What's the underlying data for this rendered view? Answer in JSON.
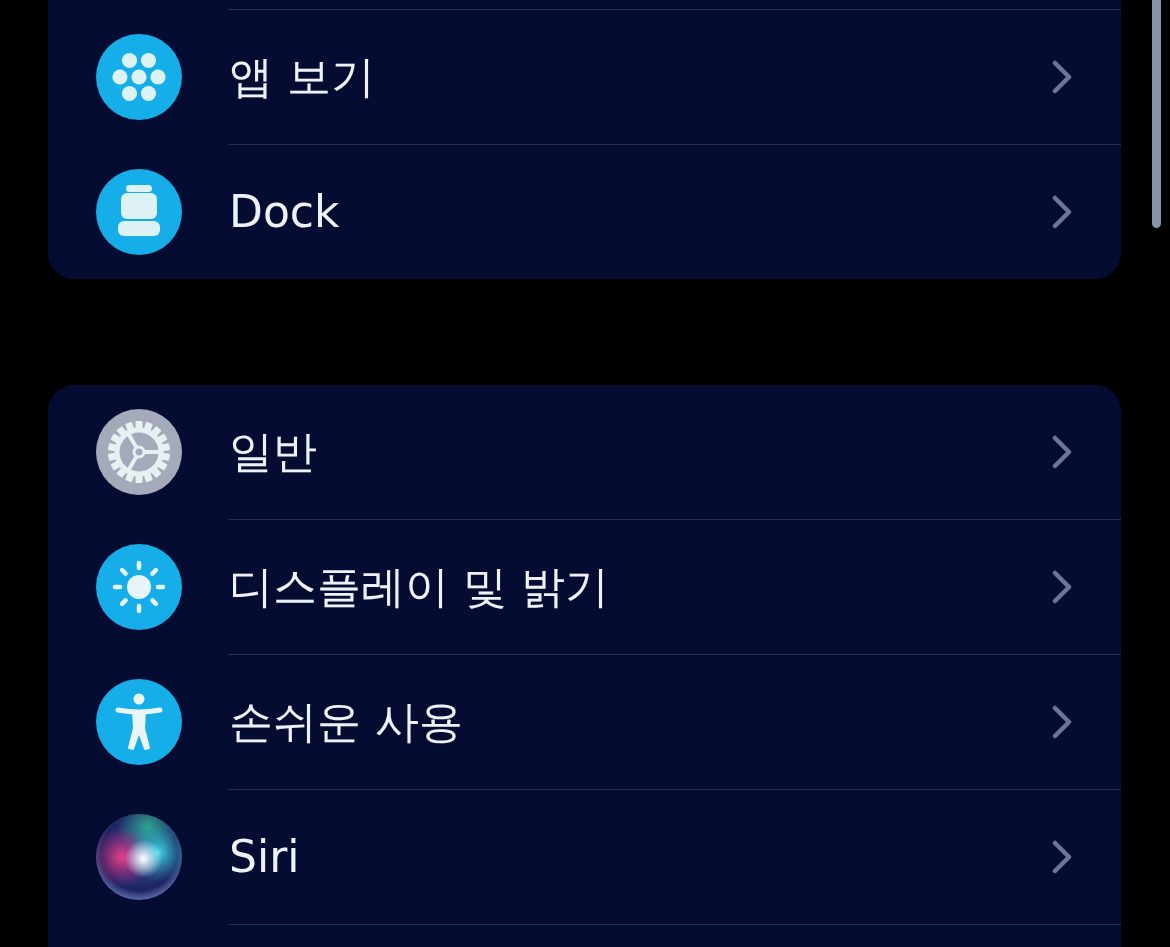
{
  "groups": [
    {
      "continues_above": true,
      "continues_below": false,
      "items": [
        {
          "kind": "apps",
          "label": "앱 보기"
        },
        {
          "kind": "dock",
          "label": "Dock"
        }
      ]
    },
    {
      "continues_above": false,
      "continues_below": true,
      "items": [
        {
          "kind": "general",
          "label": "일반"
        },
        {
          "kind": "display",
          "label": "디스플레이 및 밝기"
        },
        {
          "kind": "accessibility",
          "label": "손쉬운 사용"
        },
        {
          "kind": "siri",
          "label": "Siri"
        }
      ]
    }
  ]
}
